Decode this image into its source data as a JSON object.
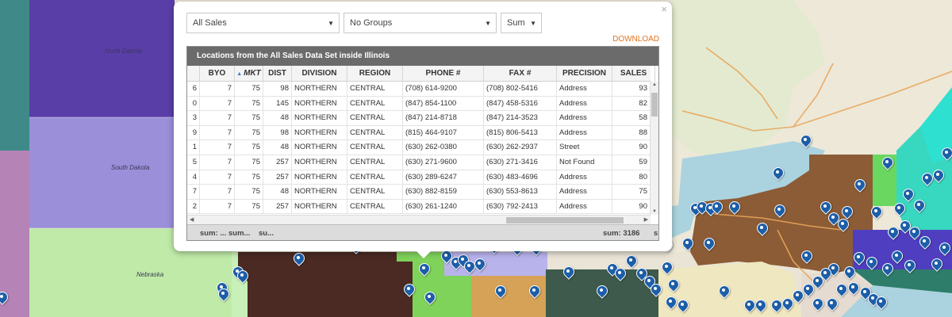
{
  "map": {
    "labels": {
      "north_dakota": "North Dakota",
      "south_dakota": "South Dakota",
      "nebraska": "Nebraska"
    },
    "pin_color": "#1d5ea8"
  },
  "popup": {
    "close_label": "×",
    "dataset_select": "All Sales",
    "groups_select": "No Groups",
    "aggregate_select": "Sum",
    "download_label": "DOWNLOAD",
    "grid_title": "Locations from the All Sales Data Set inside Illinois",
    "columns": [
      "BYO",
      "MKT",
      "DIST",
      "DIVISION",
      "REGION",
      "PHONE #",
      "FAX #",
      "PRECISION",
      "SALES"
    ],
    "sorted_column": "MKT",
    "rows": [
      {
        "lead": "6",
        "byo": "7",
        "mkt": "75",
        "dist": "98",
        "division": "NORTHERN",
        "region": "CENTRAL",
        "phone": "(708) 614-9200",
        "fax": "(708) 802-5416",
        "precision": "Address",
        "sales": "93"
      },
      {
        "lead": "0",
        "byo": "7",
        "mkt": "75",
        "dist": "145",
        "division": "NORTHERN",
        "region": "CENTRAL",
        "phone": "(847) 854-1100",
        "fax": "(847) 458-5316",
        "precision": "Address",
        "sales": "82"
      },
      {
        "lead": "3",
        "byo": "7",
        "mkt": "75",
        "dist": "48",
        "division": "NORTHERN",
        "region": "CENTRAL",
        "phone": "(847) 214-8718",
        "fax": "(847) 214-3523",
        "precision": "Address",
        "sales": "58"
      },
      {
        "lead": "9",
        "byo": "7",
        "mkt": "75",
        "dist": "98",
        "division": "NORTHERN",
        "region": "CENTRAL",
        "phone": "(815) 464-9107",
        "fax": "(815) 806-5413",
        "precision": "Address",
        "sales": "88"
      },
      {
        "lead": "1",
        "byo": "7",
        "mkt": "75",
        "dist": "48",
        "division": "NORTHERN",
        "region": "CENTRAL",
        "phone": "(630) 262-0380",
        "fax": "(630) 262-2937",
        "precision": "Street",
        "sales": "90"
      },
      {
        "lead": "5",
        "byo": "7",
        "mkt": "75",
        "dist": "257",
        "division": "NORTHERN",
        "region": "CENTRAL",
        "phone": "(630) 271-9600",
        "fax": "(630) 271-3416",
        "precision": "Not Found",
        "sales": "59"
      },
      {
        "lead": "4",
        "byo": "7",
        "mkt": "75",
        "dist": "257",
        "division": "NORTHERN",
        "region": "CENTRAL",
        "phone": "(630) 289-6247",
        "fax": "(630) 483-4696",
        "precision": "Address",
        "sales": "80"
      },
      {
        "lead": "7",
        "byo": "7",
        "mkt": "75",
        "dist": "48",
        "division": "NORTHERN",
        "region": "CENTRAL",
        "phone": "(630) 882-8159",
        "fax": "(630) 553-8613",
        "precision": "Address",
        "sales": "75"
      },
      {
        "lead": "2",
        "byo": "7",
        "mkt": "75",
        "dist": "257",
        "division": "NORTHERN",
        "region": "CENTRAL",
        "phone": "(630) 261-1240",
        "fax": "(630) 792-2413",
        "precision": "Address",
        "sales": "90"
      }
    ],
    "footer": {
      "sum_byo": "sum: ...",
      "sum_mkt": "sum...",
      "sum_dist": "su...",
      "sum_sales": "sum: 3186",
      "sum_next": "s"
    }
  }
}
